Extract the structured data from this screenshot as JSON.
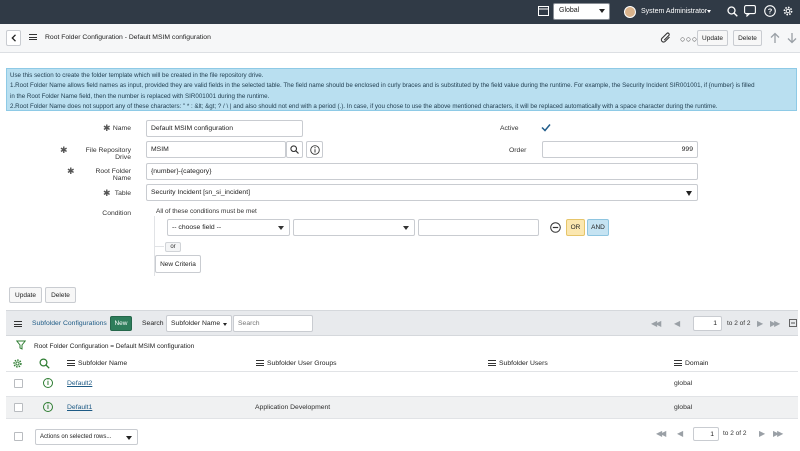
{
  "banner": {
    "scope": "Global",
    "user": "System Administrator"
  },
  "header": {
    "title": "Root Folder Configuration - Default MSIM configuration",
    "update_label": "Update",
    "delete_label": "Delete"
  },
  "info": {
    "line1": "Use this section to create the folder template which will be created in the file repository drive.",
    "line2": "1.Root Folder Name allows field names as input, provided they are valid fields in the selected table. The field name should be enclosed in curly braces and is substituted by the field value during the runtime. For example, the Security Incident SIR001001, if {number} is filled",
    "line3": "in the Root Folder Name field, then the number is replaced with SIR001001 during the runtime.",
    "line4": "2.Root Folder Name does not support any of these characters: \" * : &lt; &gt; ? / \\ | and also should not end with a period (.). In case, if you chose to use the above mentioned characters, it will be replaced automatically with a space character during the runtime."
  },
  "form": {
    "name_label": "Name",
    "name_value": "Default MSIM configuration",
    "active_label": "Active",
    "drive_label": "File Repository Drive",
    "drive_value": "MSIM",
    "order_label": "Order",
    "order_value": "999",
    "root_label": "Root Folder Name",
    "root_value": "{number}-{category}",
    "table_label": "Table",
    "table_value": "Security Incident [sn_si_incident]",
    "condition_label": "Condition",
    "conditions_text": "All of these conditions must be met",
    "choose_field": "-- choose field --",
    "or_label": "OR",
    "and_label": "AND",
    "or_small": "or",
    "new_criteria": "New Criteria",
    "update_label": "Update",
    "delete_label": "Delete"
  },
  "related": {
    "title": "Subfolder Configurations",
    "new_label": "New",
    "search_label": "Search",
    "search_field": "Subfolder Name",
    "search_placeholder": "Search",
    "page_value": "1",
    "page_text": "to 2 of 2",
    "breadcrumb": "Root Folder Configuration = Default MSIM configuration",
    "columns": [
      "Subfolder Name",
      "Subfolder User Groups",
      "Subfolder Users",
      "Domain"
    ],
    "rows": [
      {
        "name": "Default2",
        "groups": "",
        "users": "",
        "domain": "global"
      },
      {
        "name": "Default1",
        "groups": "Application Development",
        "users": "",
        "domain": "global"
      }
    ],
    "actions_label": "Actions on selected rows..."
  }
}
